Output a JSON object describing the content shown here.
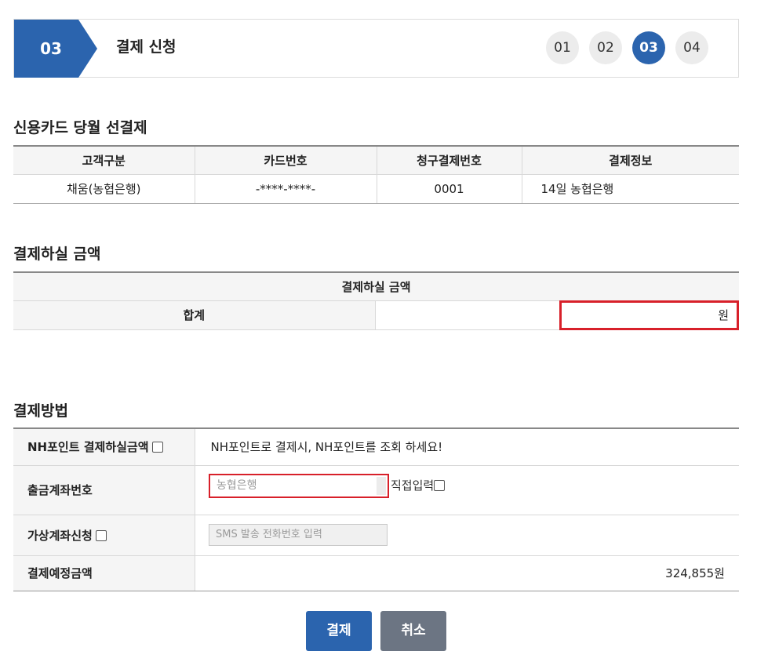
{
  "step": {
    "number": "03",
    "title": "결제 신청",
    "indicators": [
      "01",
      "02",
      "03",
      "04"
    ],
    "active_index": 2,
    "accent_color": "#2b64ae"
  },
  "card_section": {
    "title": "신용카드 당월 선결제",
    "headers": [
      "고객구분",
      "카드번호",
      "청구결제번호",
      "결제정보"
    ],
    "row": [
      "채움(농협은행)",
      "-****-****-",
      "0001",
      "14일 농협은행"
    ]
  },
  "amount_section": {
    "title": "결제하실 금액",
    "header": "결제하실 금액",
    "total_label": "합계",
    "unit": "원"
  },
  "method_section": {
    "title": "결제방법",
    "nh_point_label": "NH포인트 결제하실금액",
    "nh_point_note": "NH포인트로 결제시, NH포인트를 조회 하세요!",
    "account_label": "출금계좌번호",
    "account_placeholder": "농협은행",
    "direct_input_label": "직접입력",
    "virtual_account_label": "가상계좌신청",
    "sms_placeholder": "SMS 발송 전화번호 입력",
    "scheduled_amount_label": "결제예정금액",
    "scheduled_amount_value": "324,855원"
  },
  "buttons": {
    "pay": "결제",
    "cancel": "취소"
  }
}
